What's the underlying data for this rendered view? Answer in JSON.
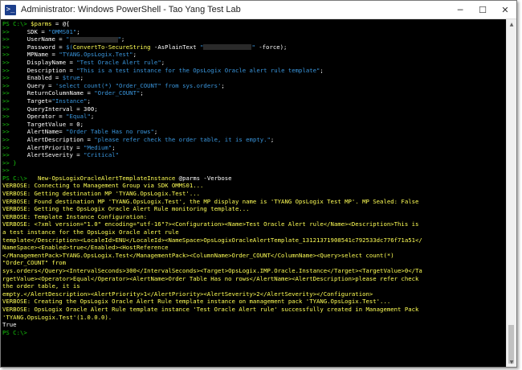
{
  "window": {
    "title": "Administrator: Windows PowerShell - Tao Yang Test Lab",
    "icon": "powershell-icon",
    "minimize": "─",
    "maximize": "☐",
    "close": "✕"
  },
  "console": {
    "lines": [
      [
        [
          "g",
          "PS C:\\> "
        ],
        [
          "y",
          "$parms"
        ],
        [
          "w",
          " = @{"
        ]
      ],
      [
        [
          "g",
          ">>     "
        ],
        [
          "w",
          "SDK = "
        ],
        [
          "c",
          "\"OMMS01\""
        ],
        [
          "w",
          ";"
        ]
      ],
      [
        [
          "g",
          ">>     "
        ],
        [
          "w",
          "UserName = "
        ],
        [
          "c",
          "\""
        ],
        [
          "r",
          ""
        ],
        [
          "c",
          "\""
        ],
        [
          "w",
          ";"
        ]
      ],
      [
        [
          "g",
          ">>     "
        ],
        [
          "w",
          "Password = "
        ],
        [
          "c",
          "$("
        ],
        [
          "y",
          "ConvertTo-SecureString"
        ],
        [
          "w",
          " -AsPlainText "
        ],
        [
          "c",
          "\""
        ],
        [
          "r",
          ""
        ],
        [
          "c",
          "\""
        ],
        [
          "w",
          " -force);"
        ]
      ],
      [
        [
          "g",
          ">>     "
        ],
        [
          "w",
          "MPName = "
        ],
        [
          "c",
          "\"TYANG.OpsLogix.Test\""
        ],
        [
          "w",
          ";"
        ]
      ],
      [
        [
          "g",
          ">>     "
        ],
        [
          "w",
          "DisplayName = "
        ],
        [
          "c",
          "\"Test Oracle Alert rule\""
        ],
        [
          "w",
          ";"
        ]
      ],
      [
        [
          "g",
          ">>     "
        ],
        [
          "w",
          "Description = "
        ],
        [
          "c",
          "\"This is a test instance for the OpsLogix Oracle alert rule template\""
        ],
        [
          "w",
          ";"
        ]
      ],
      [
        [
          "g",
          ">>     "
        ],
        [
          "w",
          "Enabled = "
        ],
        [
          "c",
          "$true"
        ],
        [
          "w",
          ";"
        ]
      ],
      [
        [
          "g",
          ">>     "
        ],
        [
          "w",
          "Query = "
        ],
        [
          "c",
          "'select count(*) \"Order_COUNT\" from sys.orders'"
        ],
        [
          "w",
          ";"
        ]
      ],
      [
        [
          "g",
          ">>     "
        ],
        [
          "w",
          "ReturnColumnName = "
        ],
        [
          "c",
          "\"Order_COUNT\""
        ],
        [
          "w",
          ";"
        ]
      ],
      [
        [
          "g",
          ">>     "
        ],
        [
          "w",
          "Target="
        ],
        [
          "c",
          "\"Instance\""
        ],
        [
          "w",
          ";"
        ]
      ],
      [
        [
          "g",
          ">>     "
        ],
        [
          "w",
          "QueryInterval = 300;"
        ]
      ],
      [
        [
          "g",
          ">>     "
        ],
        [
          "w",
          "Operator = "
        ],
        [
          "c",
          "\"Equal\""
        ],
        [
          "w",
          ";"
        ]
      ],
      [
        [
          "g",
          ">>     "
        ],
        [
          "w",
          "TargetValue = 0;"
        ]
      ],
      [
        [
          "g",
          ">>     "
        ],
        [
          "w",
          "AlertName= "
        ],
        [
          "c",
          "\"Order Table Has no rows\""
        ],
        [
          "w",
          ";"
        ]
      ],
      [
        [
          "g",
          ">>     "
        ],
        [
          "w",
          "AlertDescription = "
        ],
        [
          "c",
          "\"please refer check the order table, it is empty.\""
        ],
        [
          "w",
          ";"
        ]
      ],
      [
        [
          "g",
          ">>     "
        ],
        [
          "w",
          "AlertPriority = "
        ],
        [
          "c",
          "\"Medium\""
        ],
        [
          "w",
          ";"
        ]
      ],
      [
        [
          "g",
          ">>     "
        ],
        [
          "w",
          "AlertSeverity = "
        ],
        [
          "c",
          "\"Critical\""
        ]
      ],
      [
        [
          "g",
          ">> }"
        ]
      ],
      [
        [
          "g",
          ">> "
        ]
      ],
      [
        [
          "g",
          "PS C:\\>   "
        ],
        [
          "y",
          "New-OpsLogixOracleAlertTemplateInstance"
        ],
        [
          "w",
          " @parms -Verbose"
        ]
      ],
      [
        [
          "y",
          "VERBOSE: Connecting to Management Group via SDK OMMS01..."
        ]
      ],
      [
        [
          "y",
          "VERBOSE: Getting destination MP 'TYANG.OpsLogix.Test'..."
        ]
      ],
      [
        [
          "y",
          "VERBOSE: Found destination MP 'TYANG.OpsLogix.Test', the MP display name is 'TYANG OpsLogix Test MP'. MP Sealed: False"
        ]
      ],
      [
        [
          "y",
          "VERBOSE: Getting the OpsLogix Oracle Alert Rule monitoring template..."
        ]
      ],
      [
        [
          "y",
          "VERBOSE: Template Instance Configuration:"
        ]
      ],
      [
        [
          "y",
          "VERBOSE: <?xml version=\"1.0\" encoding=\"utf-16\"?><Configuration><Name>Test Oracle Alert rule</Name><Description>This is"
        ]
      ],
      [
        [
          "y",
          "a test instance for the OpsLogix Oracle alert rule"
        ]
      ],
      [
        [
          "y",
          "template</Description><LocaleId>ENU</LocaleId><NameSpace>OpsLogixOracleAlertTemplate_13121371908541c792533dc776f71a51</"
        ]
      ],
      [
        [
          "y",
          "NameSpace><Enabled>true</Enabled><HostReference"
        ]
      ],
      [
        [
          "y",
          "</ManagementPack>TYANG.OpsLogix.Test</ManagementPack><ColumnName>Order_COUNT</ColumnName><Query>select count(*)"
        ]
      ],
      [
        [
          "y",
          "\"Order_COUNT\" from"
        ]
      ],
      [
        [
          "y",
          "sys.orders</Query><IntervalSeconds>300</IntervalSeconds><Target>OpsLogix.IMP.Oracle.Instance</Target><TargetValue>0</Ta"
        ]
      ],
      [
        [
          "y",
          "rgetValue><Operator>Equal</Operator><AlertName>Order Table Has no rows</AlertName><AlertDescription>please refer check"
        ]
      ],
      [
        [
          "y",
          "the order table, it is"
        ]
      ],
      [
        [
          "y",
          "empty.</AlertDescription><AlertPriority>1</AlertPriority><AlertSeverity>2</AlertSeverity></Configuration>"
        ]
      ],
      [
        [
          "y",
          "VERBOSE: Creating the OpsLogix Oracle Alert Rule template instance on management pack 'TYANG.OpsLogix.Test'..."
        ]
      ],
      [
        [
          "y",
          "VERBOSE: OpsLogix Oracle Alert Rule template instance 'Test Oracle Alert rule' successfully created in Management Pack"
        ]
      ],
      [
        [
          "y",
          "'TYANG.OpsLogix.Test'(1.0.0.0)."
        ]
      ],
      [
        [
          "w",
          "True"
        ]
      ],
      [
        [
          "g",
          "PS C:\\> "
        ]
      ]
    ]
  },
  "scrollbar": {
    "up_arrow": "▲",
    "down_arrow": "▼"
  }
}
